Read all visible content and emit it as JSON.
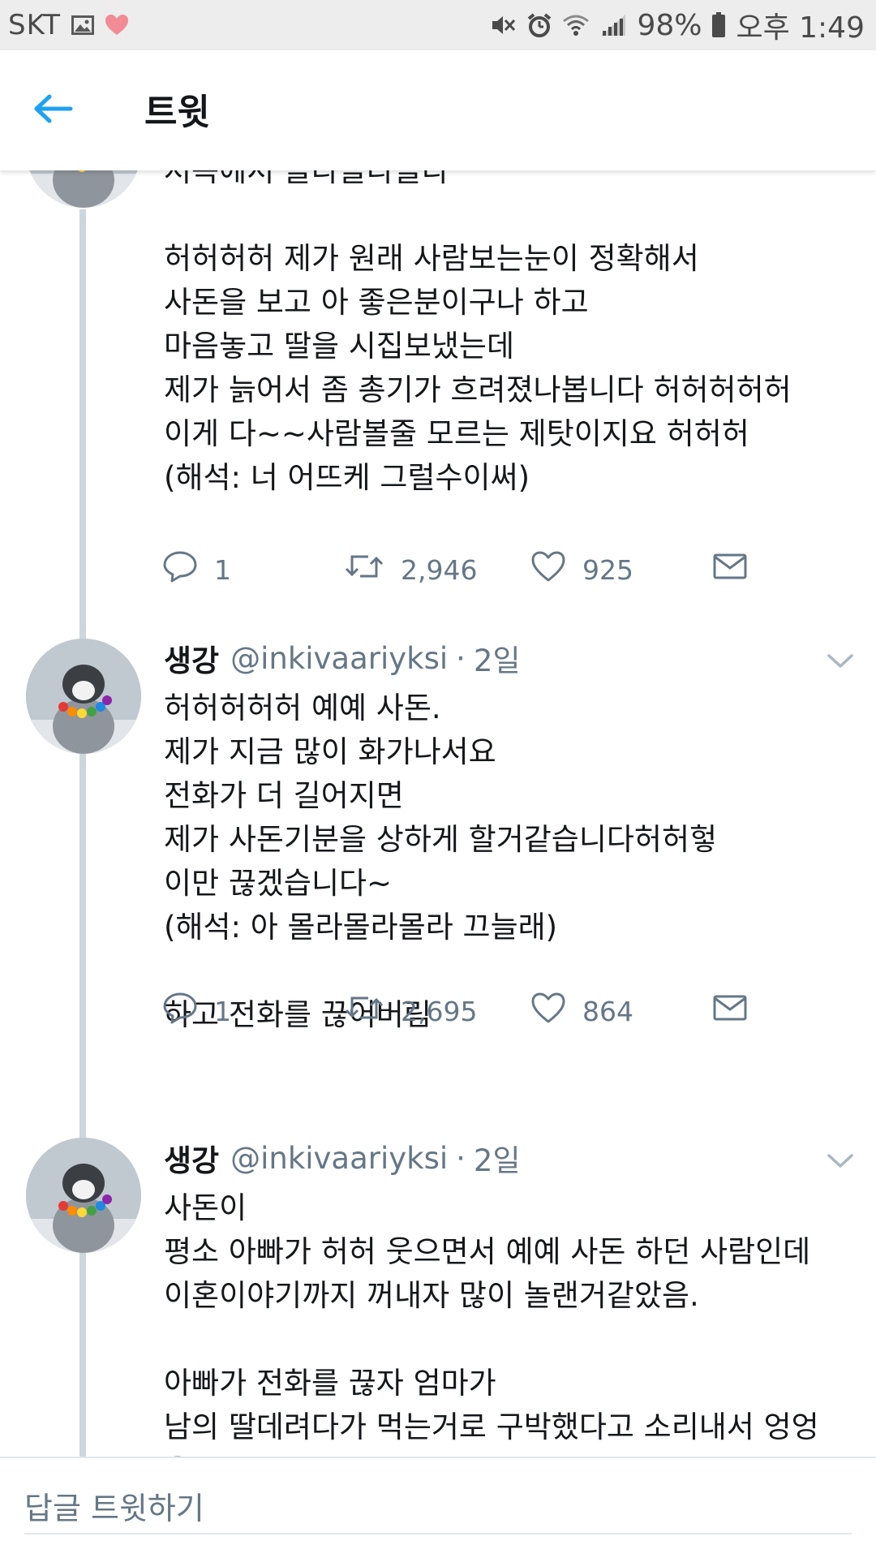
{
  "status_bar": {
    "carrier": "SKT",
    "battery": "98%",
    "time": "오후 1:49",
    "icons": [
      "gallery-icon",
      "heart-icon",
      "mute-icon",
      "alarm-icon",
      "wifi-icon",
      "signal-icon",
      "battery-icon"
    ],
    "heart_color": "#f28b96"
  },
  "header": {
    "title": "트윗",
    "back_icon": "arrow-left-icon",
    "accent_color": "#1da1f2"
  },
  "tweets": [
    {
      "name": "",
      "handle": "",
      "time": "",
      "text": "저쪽에서 블라블라블라\n\n허허허허 제가 원래 사람보는눈이 정확해서\n사돈을 보고 아 좋은분이구나 하고\n마음놓고 딸을 시집보냈는데\n제가 늙어서 좀 총기가 흐려졌나봅니다 허허허허허\n이게 다~~사람볼줄 모르는 제탓이지요 허허허\n(해석: 너 어뜨케 그럴수이써)",
      "replies": "1",
      "retweets": "2,946",
      "likes": "925"
    },
    {
      "name": "생강",
      "handle": "@inkivaariyksi",
      "time": "2일",
      "text": "허허허허허 예예 사돈.\n제가 지금 많이 화가나서요\n전화가 더 길어지면\n제가 사돈기분을 상하게 할거같습니다허허헣\n이만 끊겠습니다~\n(해석: 아 몰라몰라몰라 끄늘래)\n\n하고 전화를 끊어버림",
      "replies": "1",
      "retweets": "2,695",
      "likes": "864"
    },
    {
      "name": "생강",
      "handle": "@inkivaariyksi",
      "time": "2일",
      "text": "사돈이\n평소 아빠가 허허 웃으면서 예예 사돈 하던 사람인데\n이혼이야기까지 꺼내자 많이 놀랜거같았음.\n\n아빠가 전화를 끊자 엄마가\n남의 딸데려다가 먹는거로 구박했다고 소리내서 엉엉 욺."
    }
  ],
  "reply_bar": {
    "placeholder": "답글 트윗하기"
  }
}
